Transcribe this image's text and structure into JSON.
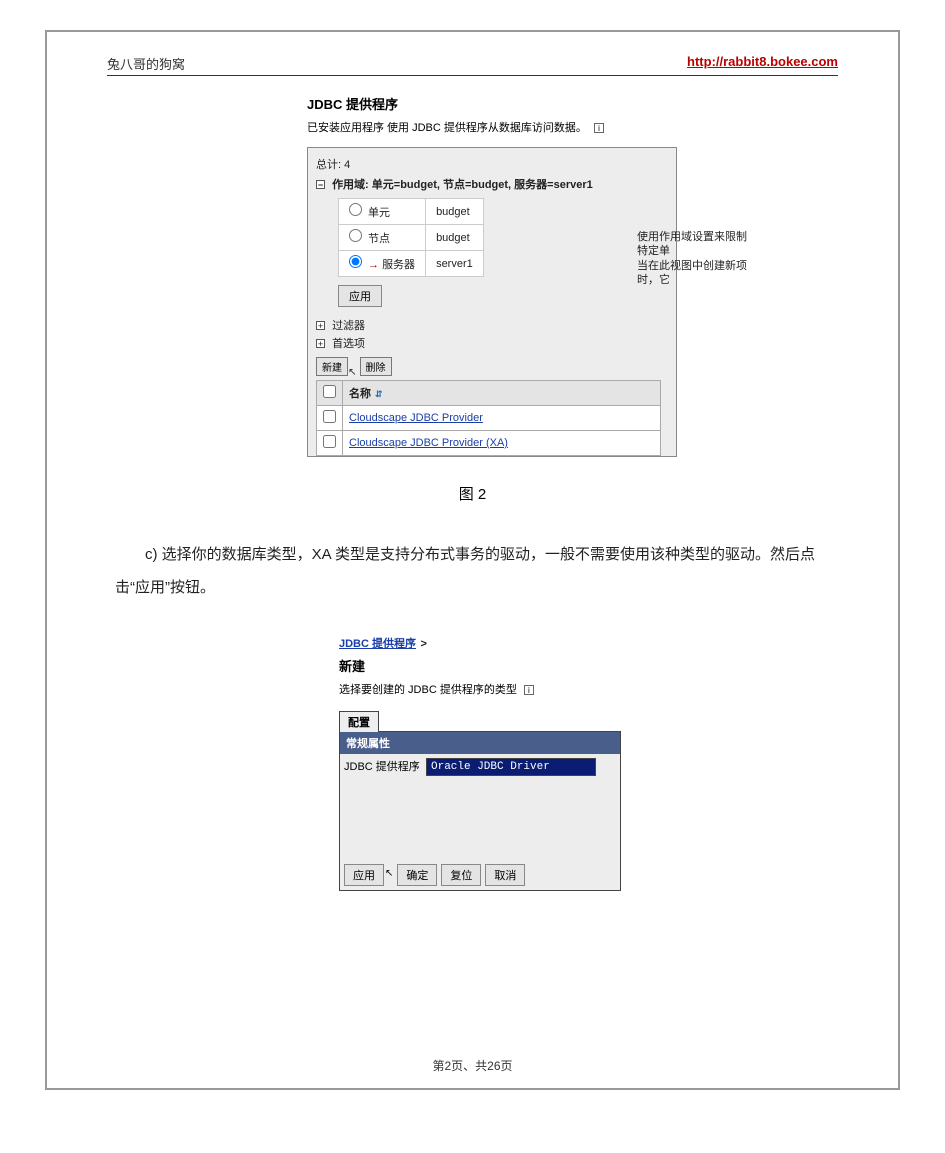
{
  "header": {
    "blog_name": "兔八哥的狗窝",
    "blog_url": "http://rabbit8.bokee.com"
  },
  "figure1": {
    "title": "JDBC 提供程序",
    "subtitle": "已安装应用程序 使用 JDBC 提供程序从数据库访问数据。",
    "total_line": "总计: 4",
    "scope_label": "作用域: 单元=budget, 节点=budget, 服务器=server1",
    "scope_rows": [
      {
        "label": "单元",
        "value": "budget",
        "checked": false
      },
      {
        "label": "节点",
        "value": "budget",
        "checked": false
      },
      {
        "label": "服务器",
        "value": "server1",
        "checked": true
      }
    ],
    "side_note1": "使用作用域设置来限制特定单",
    "side_note2": "当在此视图中创建新项时，它",
    "apply": "应用",
    "filter": "过滤器",
    "prefs": "首选项",
    "btn_new": "新建",
    "btn_del": "删除",
    "name_col": "名称",
    "providers": [
      "Cloudscape JDBC Provider",
      "Cloudscape JDBC Provider (XA)"
    ]
  },
  "caption1": "图 2",
  "para_c": "c) 选择你的数据库类型，XA 类型是支持分布式事务的驱动，一般不需要使用该种类型的驱动。然后点击“应用”按钮。",
  "figure2": {
    "crumb_link": "JDBC 提供程序",
    "crumb_sep": ">",
    "title": "新建",
    "subtitle": "选择要创建的 JDBC 提供程序的类型",
    "tab": "配置",
    "genprops": "常规属性",
    "field_label": "JDBC 提供程序",
    "select_value": "Oracle JDBC Driver",
    "buttons": [
      "应用",
      "确定",
      "复位",
      "取消"
    ]
  },
  "footer": "第2页、共26页"
}
